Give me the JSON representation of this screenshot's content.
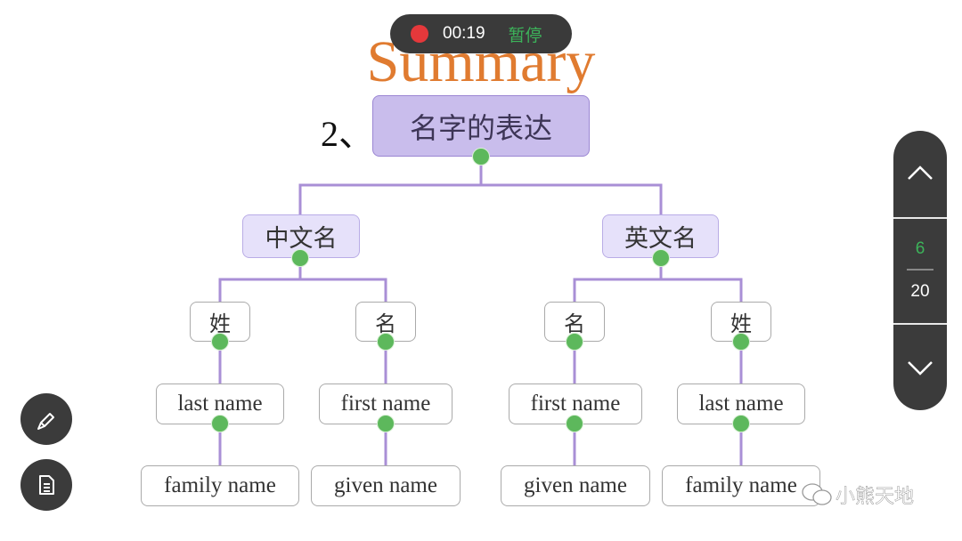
{
  "recording": {
    "time": "00:19",
    "pause_label": "暂停",
    "colors": {
      "record_dot": "#e5383b",
      "pause_text": "#3cb35a"
    }
  },
  "slide": {
    "title": "Summary",
    "section_number": "2、",
    "root": "名字的表达",
    "branches": [
      {
        "label": "中文名",
        "children": [
          {
            "label": "姓",
            "english": "last name",
            "synonym": "family name"
          },
          {
            "label": "名",
            "english": "first name",
            "synonym": "given name"
          }
        ]
      },
      {
        "label": "英文名",
        "children": [
          {
            "label": "名",
            "english": "first name",
            "synonym": "given name"
          },
          {
            "label": "姓",
            "english": "last name",
            "synonym": "family name"
          }
        ]
      }
    ],
    "colors": {
      "title": "#e07b30",
      "connector": "#a98fd6",
      "knob": "#5db85c",
      "root_fill": "#c9bdec"
    }
  },
  "pager": {
    "current_page": "6",
    "total_pages": "20",
    "up_icon": "chevron-up-icon",
    "down_icon": "chevron-down-icon"
  },
  "tools": {
    "pen_icon": "pencil-icon",
    "doc_icon": "document-icon"
  },
  "watermark": {
    "icon": "wechat-icon",
    "text": "小熊天地"
  }
}
